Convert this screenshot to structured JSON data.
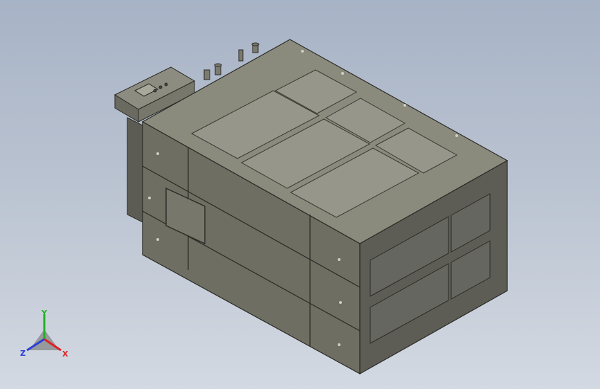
{
  "window": {
    "kind": "cad-graphics-viewport"
  },
  "triad": {
    "x_label": "X",
    "y_label": "Y",
    "z_label": "Z",
    "colors": {
      "x": "#e02020",
      "y": "#22b022",
      "z": "#2a3fd8"
    }
  },
  "colors": {
    "background_top": "#a7b3c6",
    "background_bottom": "#d3d9e2",
    "body_front": "#6e6e63",
    "body_top": "#8a8a7d",
    "body_side": "#5d5d56",
    "edge": "#2a2a26"
  },
  "model": {
    "icon": "enclosure-3d-model"
  }
}
